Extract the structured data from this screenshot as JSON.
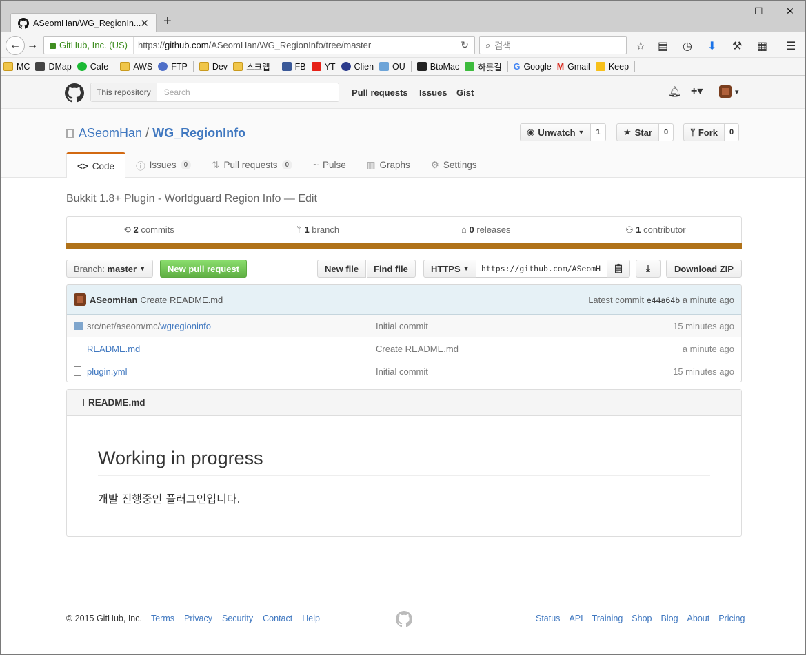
{
  "browser": {
    "tab_title": "ASeomHan/WG_RegionIn...",
    "tab_close": "✕",
    "new_tab": "+",
    "window_controls": [
      "—",
      "☐",
      "✕"
    ],
    "identity": "GitHub, Inc. (US)",
    "url_prefix": "https://",
    "url_domain": "github.com",
    "url_path": "/ASeomHan/WG_RegionInfo/tree/master",
    "search_placeholder": "검색",
    "bookmarks": [
      {
        "label": "MC",
        "icon": "folder-icon"
      },
      {
        "label": "DMap",
        "icon": "cube-icon"
      },
      {
        "label": "Cafe",
        "icon": "cafe-icon"
      },
      {
        "label": "AWS",
        "icon": "folder-icon"
      },
      {
        "label": "FTP",
        "icon": "ftp-icon"
      },
      {
        "label": "Dev",
        "icon": "folder-icon"
      },
      {
        "label": "스크랩",
        "icon": "folder-icon"
      },
      {
        "label": "FB",
        "icon": "facebook-icon"
      },
      {
        "label": "YT",
        "icon": "youtube-icon"
      },
      {
        "label": "Clien",
        "icon": "clien-icon"
      },
      {
        "label": "OU",
        "icon": "ou-icon"
      },
      {
        "label": "BtoMac",
        "icon": "btomac-icon"
      },
      {
        "label": "하룻길",
        "icon": "blog-icon"
      },
      {
        "label": "Google",
        "icon": "google-icon"
      },
      {
        "label": "Gmail",
        "icon": "gmail-icon"
      },
      {
        "label": "Keep",
        "icon": "keep-icon"
      }
    ]
  },
  "github": {
    "search_scope": "This repository",
    "search_placeholder": "Search",
    "nav": [
      "Pull requests",
      "Issues",
      "Gist"
    ],
    "plus": "+▾",
    "avatar_caret": "▾"
  },
  "repo": {
    "owner": "ASeomHan",
    "separator": "/",
    "name": "WG_RegionInfo",
    "watch": {
      "label": "Unwatch",
      "count": "1"
    },
    "star": {
      "label": "Star",
      "count": "0"
    },
    "fork": {
      "label": "Fork",
      "count": "0"
    },
    "tabs": [
      {
        "label": "Code",
        "icon": "<>",
        "counter": ""
      },
      {
        "label": "Issues",
        "icon": "ⓘ",
        "counter": "0"
      },
      {
        "label": "Pull requests",
        "icon": "⇅",
        "counter": "0"
      },
      {
        "label": "Pulse",
        "icon": "~",
        "counter": ""
      },
      {
        "label": "Graphs",
        "icon": "▥",
        "counter": ""
      },
      {
        "label": "Settings",
        "icon": "⚙",
        "counter": ""
      }
    ],
    "description": "Bukkit 1.8+ Plugin - Worldguard Region Info",
    "description_edit": "— Edit",
    "summary": [
      {
        "icon": "⟲",
        "num": "2",
        "label": "commits"
      },
      {
        "icon": "ᛘ",
        "num": "1",
        "label": "branch"
      },
      {
        "icon": "⌂",
        "num": "0",
        "label": "releases"
      },
      {
        "icon": "⚇",
        "num": "1",
        "label": "contributor"
      }
    ],
    "language_color": "#b07219"
  },
  "filenav": {
    "branch_label": "Branch:",
    "branch": "master",
    "new_pr": "New pull request",
    "new_file": "New file",
    "find_file": "Find file",
    "protocol": "HTTPS",
    "clone_url": "https://github.com/ASeomH",
    "download": "Download ZIP"
  },
  "latest_commit": {
    "author": "ASeomHan",
    "message": "Create README.md",
    "label": "Latest commit",
    "sha": "e44a64b",
    "age": "a minute ago"
  },
  "files": [
    {
      "type": "folder",
      "dim": "src/net/aseom/mc/",
      "name": "wgregioninfo",
      "message": "Initial commit",
      "age": "15 minutes ago"
    },
    {
      "type": "file",
      "dim": "",
      "name": "README.md",
      "message": "Create README.md",
      "age": "a minute ago"
    },
    {
      "type": "file",
      "dim": "",
      "name": "plugin.yml",
      "message": "Initial commit",
      "age": "15 minutes ago"
    }
  ],
  "readme": {
    "filename": "README.md",
    "heading": "Working in progress",
    "body": "개발 진행중인 플러그인입니다."
  },
  "footer": {
    "copyright": "© 2015 GitHub, Inc.",
    "left_links": [
      "Terms",
      "Privacy",
      "Security",
      "Contact",
      "Help"
    ],
    "right_links": [
      "Status",
      "API",
      "Training",
      "Shop",
      "Blog",
      "About",
      "Pricing"
    ]
  }
}
